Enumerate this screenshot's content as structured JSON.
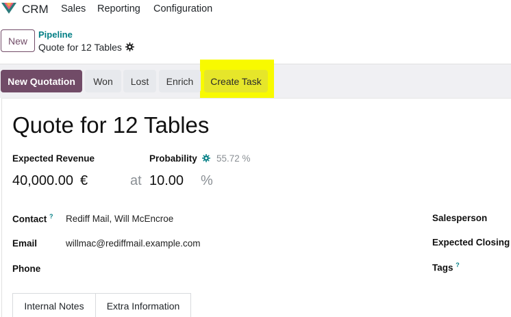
{
  "nav": {
    "app_name": "CRM",
    "items": [
      "Sales",
      "Reporting",
      "Configuration"
    ]
  },
  "breadcrumb": {
    "new_label": "New",
    "parent": "Pipeline",
    "current": "Quote for 12 Tables"
  },
  "actions": {
    "new_quotation": "New Quotation",
    "won": "Won",
    "lost": "Lost",
    "enrich": "Enrich",
    "create_task": "Create Task"
  },
  "form": {
    "title": "Quote for 12 Tables",
    "expected_revenue_label": "Expected Revenue",
    "expected_revenue": "40,000.00",
    "currency": "€",
    "at": "at",
    "probability_label": "Probability",
    "probability_auto": "55.72 %",
    "probability_value": "10.00",
    "percent": "%",
    "contact_label": "Contact",
    "contact_help": "?",
    "contact_value": "Rediff Mail, Will McEncroe",
    "email_label": "Email",
    "email_value": "willmac@rediffmail.example.com",
    "phone_label": "Phone",
    "salesperson_label": "Salesperson",
    "expected_closing_label": "Expected Closing",
    "expected_closing_help": "?",
    "tags_label": "Tags",
    "tags_help": "?"
  },
  "tabs": [
    "Internal Notes",
    "Extra Information"
  ],
  "colors": {
    "brand": "#714b67",
    "link": "#017e84",
    "highlight": "#f8fa00"
  }
}
